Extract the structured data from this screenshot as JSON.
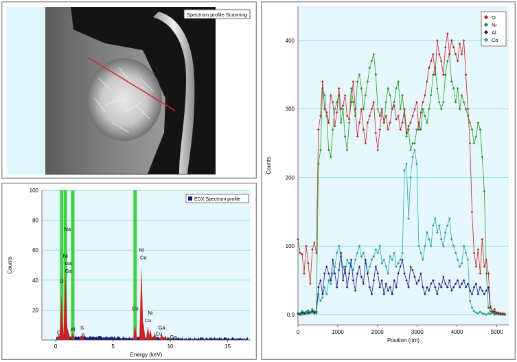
{
  "image_panel": {
    "caption": "Spectrum profile Scanning"
  },
  "colors": {
    "plot_bg": "#e6f7fd",
    "grid": "#6fd3e6",
    "oxygen": "#cc2222",
    "nickel": "#22a022",
    "aluminium": "#1a1a8c",
    "cobalt": "#22b2b2",
    "spectrum_fill": "#1a1a7a",
    "peak_fill": "#cc2222",
    "marker_bar": "#33cc33"
  },
  "chart_data": [
    {
      "type": "area",
      "legend": [
        "EDX Spectrum profile"
      ],
      "xlabel": "Energy (keV)",
      "ylabel": "Counts",
      "xlim": [
        -1.2,
        17
      ],
      "ylim": [
        0,
        100
      ],
      "x_ticks": [
        "0",
        "5",
        "10",
        "15"
      ],
      "y_ticks": [
        "100",
        "80",
        "60",
        "40",
        "20"
      ],
      "grid": true,
      "legend_position": "top-right",
      "markers_kev": [
        0.52,
        0.85,
        1.49,
        6.93
      ],
      "peaks": [
        {
          "e": 0.28,
          "h": 4
        },
        {
          "e": 0.52,
          "h": 30
        },
        {
          "e": 0.85,
          "h": 46
        },
        {
          "e": 0.93,
          "h": 18
        },
        {
          "e": 1.04,
          "h": 8
        },
        {
          "e": 1.1,
          "h": 6
        },
        {
          "e": 1.49,
          "h": 5
        },
        {
          "e": 2.31,
          "h": 4
        },
        {
          "e": 6.93,
          "h": 10
        },
        {
          "e": 7.48,
          "h": 50
        },
        {
          "e": 7.65,
          "h": 12
        },
        {
          "e": 8.05,
          "h": 9
        },
        {
          "e": 8.26,
          "h": 7
        },
        {
          "e": 8.64,
          "h": 5
        },
        {
          "e": 9.25,
          "h": 4
        },
        {
          "e": 9.57,
          "h": 3
        }
      ],
      "annotations": [
        {
          "text": "Na",
          "e": 1.04,
          "y": 73
        },
        {
          "text": "Ni",
          "e": 0.85,
          "y": 55
        },
        {
          "text": "Ga",
          "e": 1.1,
          "y": 50
        },
        {
          "text": "Ga",
          "e": 1.1,
          "y": 45
        },
        {
          "text": "O",
          "e": 0.52,
          "y": 38
        },
        {
          "text": "C",
          "e": 0.28,
          "y": 4
        },
        {
          "text": "Al",
          "e": 1.49,
          "y": 6
        },
        {
          "text": "S",
          "e": 2.31,
          "y": 7
        },
        {
          "text": "S",
          "e": 2.4,
          "y": 2
        },
        {
          "text": "Co",
          "e": 6.93,
          "y": 20
        },
        {
          "text": "Ni",
          "e": 7.48,
          "y": 59
        },
        {
          "text": "Co",
          "e": 7.65,
          "y": 54
        },
        {
          "text": "Ni",
          "e": 8.26,
          "y": 17
        },
        {
          "text": "Cu",
          "e": 8.05,
          "y": 12
        },
        {
          "text": "Cu",
          "e": 9.0,
          "y": 3
        },
        {
          "text": "Ga",
          "e": 9.25,
          "y": 7
        },
        {
          "text": "Ga",
          "e": 10.26,
          "y": 1
        }
      ]
    },
    {
      "type": "line",
      "xlabel": "Position (nm)",
      "ylabel": "Counts",
      "xlim": [
        0,
        5300
      ],
      "ylim": [
        -15,
        450
      ],
      "x_ticks": [
        "0",
        "1000",
        "2000",
        "3000",
        "4000",
        "5000"
      ],
      "y_ticks": [
        "0.0",
        "100",
        "200",
        "300",
        "400"
      ],
      "grid": true,
      "legend_position": "top-right",
      "series": [
        {
          "name": "O",
          "values": [
            110,
            90,
            88,
            60,
            100,
            75,
            45,
            95,
            105,
            90,
            270,
            290,
            340,
            300,
            295,
            280,
            320,
            310,
            275,
            295,
            330,
            300,
            305,
            320,
            290,
            285,
            310,
            340,
            300,
            260,
            280,
            300,
            270,
            250,
            280,
            290,
            300,
            310,
            265,
            240,
            270,
            300,
            280,
            290,
            270,
            280,
            300,
            305,
            285,
            290,
            270,
            280,
            300,
            265,
            275,
            280,
            290,
            300,
            310,
            270,
            295,
            310,
            320,
            340,
            360,
            370,
            380,
            350,
            400,
            380,
            370,
            350,
            390,
            410,
            380,
            400,
            390,
            380,
            370,
            395,
            380,
            400,
            350,
            300,
            250,
            150,
            90,
            70,
            95,
            60,
            110,
            70,
            80,
            60,
            12,
            5,
            8,
            2,
            3,
            0,
            1,
            0
          ]
        },
        {
          "name": "Ni",
          "values": [
            0,
            2,
            5,
            3,
            4,
            6,
            3,
            8,
            5,
            5,
            220,
            240,
            330,
            320,
            290,
            240,
            230,
            270,
            300,
            310,
            320,
            280,
            300,
            260,
            240,
            280,
            330,
            310,
            290,
            340,
            350,
            330,
            300,
            320,
            340,
            360,
            370,
            380,
            350,
            300,
            290,
            300,
            280,
            310,
            330,
            320,
            300,
            310,
            330,
            340,
            300,
            320,
            290,
            260,
            270,
            240,
            250,
            250,
            270,
            280,
            270,
            300,
            290,
            280,
            300,
            320,
            350,
            360,
            330,
            310,
            300,
            310,
            350,
            370,
            380,
            340,
            330,
            310,
            330,
            300,
            320,
            310,
            300,
            290,
            280,
            270,
            250,
            260,
            280,
            270,
            230,
            180,
            60,
            10,
            5,
            3,
            0,
            2,
            1,
            0,
            2,
            1
          ]
        },
        {
          "name": "Al",
          "values": [
            2,
            0,
            3,
            1,
            4,
            2,
            3,
            5,
            2,
            4,
            40,
            50,
            30,
            60,
            70,
            60,
            50,
            80,
            60,
            40,
            65,
            90,
            50,
            70,
            40,
            60,
            80,
            50,
            35,
            60,
            70,
            55,
            45,
            80,
            60,
            40,
            30,
            50,
            70,
            60,
            40,
            50,
            30,
            45,
            35,
            40,
            30,
            50,
            40,
            60,
            70,
            80,
            60,
            50,
            40,
            70,
            65,
            55,
            45,
            50,
            60,
            40,
            30,
            40,
            35,
            45,
            50,
            40,
            30,
            45,
            40,
            55,
            45,
            40,
            50,
            35,
            40,
            45,
            50,
            40,
            45,
            50,
            40,
            45,
            35,
            30,
            40,
            45,
            30,
            40,
            35,
            30,
            35,
            40,
            10,
            5,
            4,
            3,
            2,
            1,
            0,
            1
          ]
        },
        {
          "name": "Co",
          "values": [
            1,
            2,
            0,
            3,
            1,
            4,
            2,
            3,
            5,
            2,
            30,
            20,
            25,
            40,
            30,
            50,
            45,
            60,
            70,
            90,
            100,
            85,
            70,
            60,
            80,
            75,
            70,
            65,
            80,
            90,
            100,
            85,
            90,
            75,
            60,
            70,
            80,
            85,
            95,
            90,
            100,
            75,
            80,
            70,
            60,
            85,
            80,
            90,
            70,
            75,
            80,
            90,
            210,
            220,
            140,
            200,
            230,
            240,
            220,
            100,
            90,
            80,
            100,
            120,
            110,
            100,
            130,
            140,
            120,
            130,
            110,
            100,
            120,
            130,
            140,
            110,
            100,
            90,
            80,
            70,
            75,
            100,
            90,
            80,
            20,
            10,
            5,
            3,
            2,
            4,
            2,
            1,
            0,
            2,
            1,
            3,
            2,
            1,
            0,
            2,
            1,
            0
          ]
        }
      ]
    }
  ]
}
